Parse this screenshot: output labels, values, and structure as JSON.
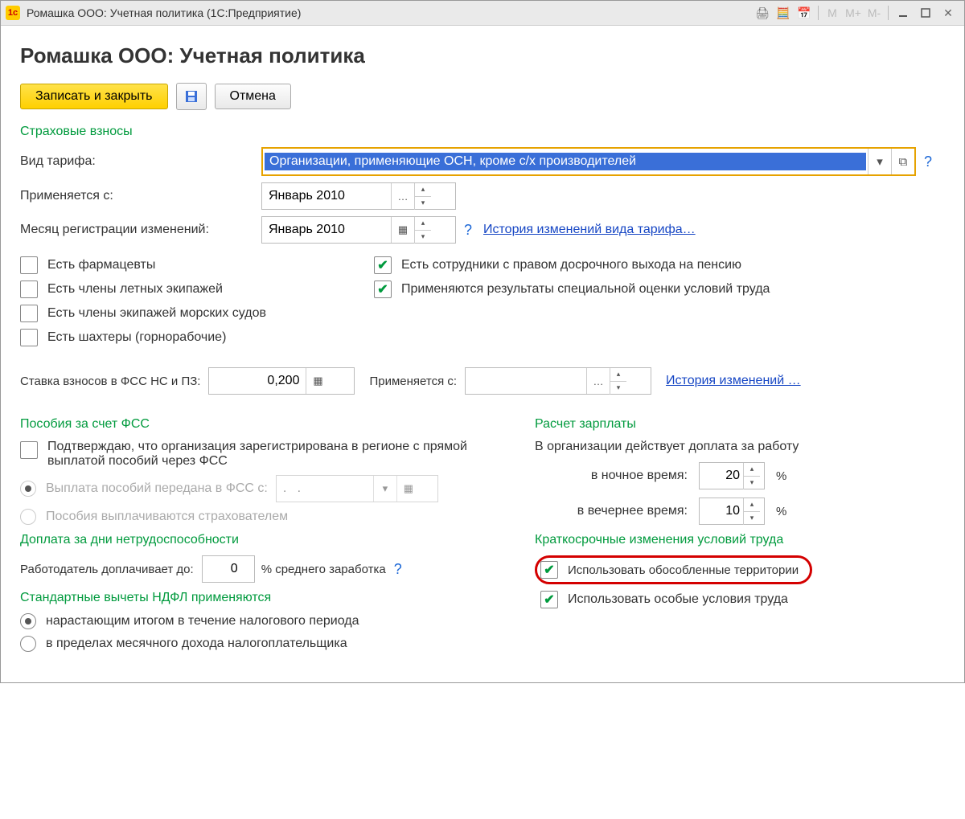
{
  "window": {
    "title": "Ромашка ООО: Учетная политика  (1С:Предприятие)"
  },
  "header": {
    "title": "Ромашка ООО: Учетная политика"
  },
  "toolbar": {
    "save_close": "Записать и закрыть",
    "cancel": "Отмена"
  },
  "insurance": {
    "title": "Страховые взносы",
    "tariff_label": "Вид тарифа:",
    "tariff_value": "Организации, применяющие ОСН, кроме с/х производителей",
    "applies_from_label": "Применяется с:",
    "applies_from_value": "Январь 2010",
    "reg_month_label": "Месяц регистрации изменений:",
    "reg_month_value": "Январь 2010",
    "history_link": "История изменений вида тарифа…"
  },
  "checks": {
    "pharmacists": "Есть фармацевты",
    "flight_crew": "Есть члены летных экипажей",
    "ship_crew": "Есть члены экипажей морских судов",
    "miners": "Есть шахтеры (горнорабочие)",
    "early_pension": "Есть сотрудники с правом досрочного выхода на пенсию",
    "special_assessment": "Применяются результаты специальной оценки условий труда"
  },
  "fss_rate": {
    "label": "Ставка взносов в ФСС НС и ПЗ:",
    "value": "0,200",
    "applies_from_label": "Применяется с:",
    "applies_from_value": "",
    "history_link": "История изменений …"
  },
  "benefits": {
    "title": "Пособия за счет ФСС",
    "confirm": "Подтверждаю, что организация зарегистрирована в регионе с прямой выплатой пособий через ФСС",
    "transfer": "Выплата пособий передана в ФСС с:",
    "transfer_value": ".   .",
    "insurer_pays": "Пособия выплачиваются страхователем"
  },
  "sickpay": {
    "title": "Доплата за дни нетрудоспособности",
    "label": "Работодатель доплачивает до:",
    "value": "0",
    "suffix": "% среднего заработка"
  },
  "ndfl": {
    "title": "Стандартные вычеты НДФЛ применяются",
    "opt1": "нарастающим итогом в течение налогового периода",
    "opt2": "в пределах месячного дохода налогоплательщика"
  },
  "salary": {
    "title": "Расчет зарплаты",
    "intro": "В организации действует доплата за работу",
    "night_label": "в ночное время:",
    "night_value": "20",
    "evening_label": "в вечернее время:",
    "evening_value": "10",
    "pct": "%"
  },
  "shortterm": {
    "title": "Краткосрочные изменения условий труда",
    "territories": "Использовать обособленные территории",
    "conditions": "Использовать особые условия труда"
  }
}
